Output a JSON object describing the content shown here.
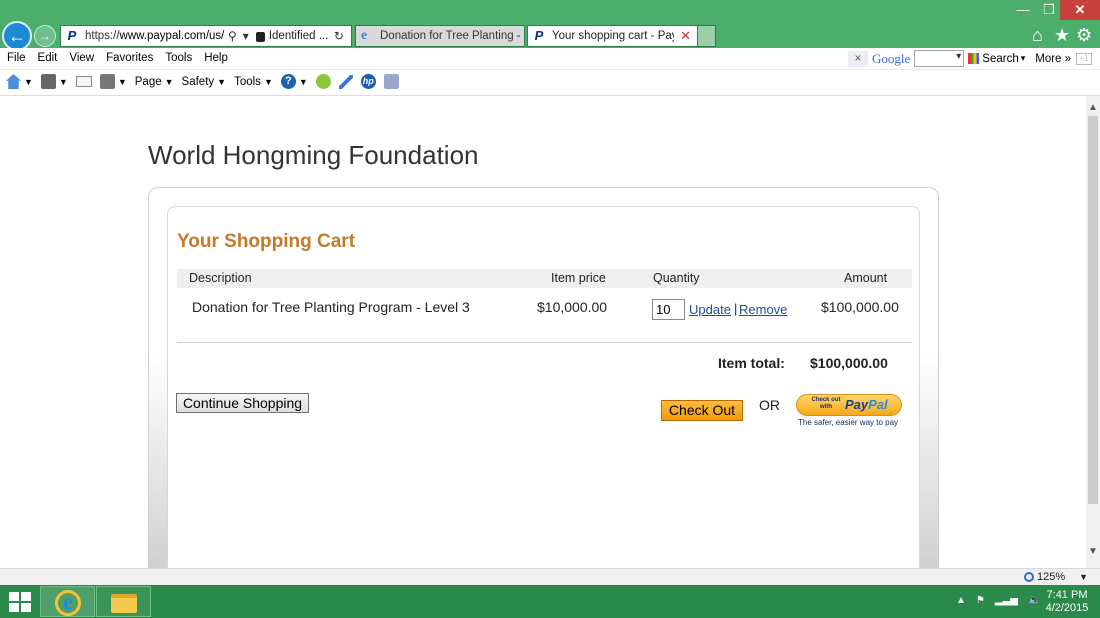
{
  "browser": {
    "address": {
      "scheme": "https://",
      "host": "www.paypal.com/us/cg",
      "identified": "Identified ..."
    },
    "tabs": [
      {
        "label": "Donation for Tree Planting - Le...",
        "active": false
      },
      {
        "label": "Your shopping cart - PayPal",
        "active": true
      }
    ],
    "menu": [
      "File",
      "Edit",
      "View",
      "Favorites",
      "Tools",
      "Help"
    ],
    "command_bar": {
      "page": "Page",
      "safety": "Safety",
      "tools": "Tools",
      "help_glyph": "?"
    },
    "google_bar": {
      "close": "×",
      "logo": "Google",
      "search": "Search",
      "more": "More »"
    },
    "status": {
      "zoom": "125%"
    }
  },
  "page": {
    "org_title": "World Hongming Foundation",
    "cart_title": "Your Shopping Cart",
    "columns": {
      "description": "Description",
      "item_price": "Item price",
      "quantity": "Quantity",
      "amount": "Amount"
    },
    "items": [
      {
        "description": "Donation for Tree Planting Program - Level 3",
        "price": "$10,000.00",
        "quantity": "10",
        "amount": "$100,000.00"
      }
    ],
    "actions": {
      "update": "Update",
      "separator": "|",
      "remove": "Remove",
      "continue": "Continue Shopping",
      "checkout": "Check Out",
      "or": "OR"
    },
    "total": {
      "label": "Item total:",
      "value": "$100,000.00"
    },
    "paypal_button": {
      "small_text": "Check out with",
      "brand_pay": "Pay",
      "brand_pal": "Pal",
      "tagline": "The safer, easier way to pay"
    }
  },
  "taskbar": {
    "time": "7:41 PM",
    "date": "4/2/2015"
  },
  "colors": {
    "window_chrome": "#4cae6b",
    "taskbar": "#2a8a4a",
    "cart_title": "#c47a2b",
    "link": "#1f4e9a",
    "checkout_button": "#f29a0a"
  }
}
